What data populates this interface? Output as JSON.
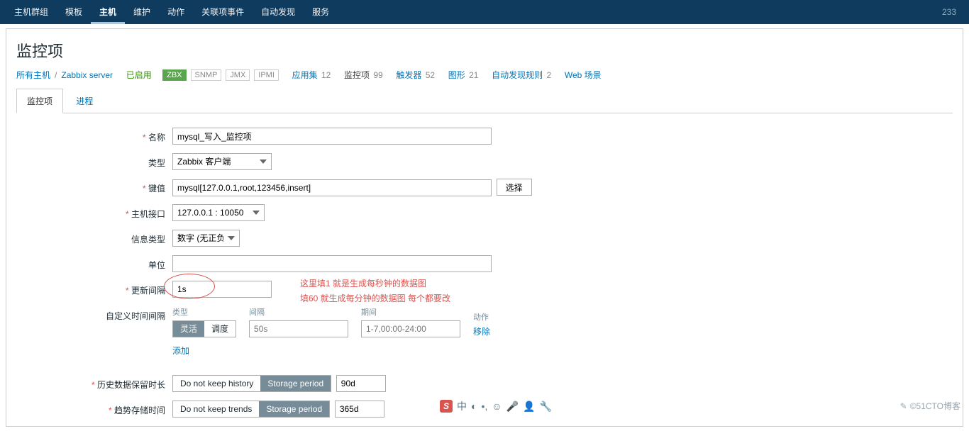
{
  "topnav": {
    "items": [
      "主机群组",
      "模板",
      "主机",
      "维护",
      "动作",
      "关联项事件",
      "自动发现",
      "服务"
    ],
    "active_index": 2,
    "right_count": "233"
  },
  "page_title": "监控项",
  "breadcrumb": {
    "all_hosts": "所有主机",
    "host": "Zabbix server",
    "enabled": "已启用",
    "tags": {
      "zbx": "ZBX",
      "snmp": "SNMP",
      "jmx": "JMX",
      "ipmi": "IPMI"
    },
    "metrics": [
      {
        "label": "应用集",
        "count": "12"
      },
      {
        "label": "监控项",
        "count": "99",
        "current": true
      },
      {
        "label": "触发器",
        "count": "52"
      },
      {
        "label": "图形",
        "count": "21"
      },
      {
        "label": "自动发现规则",
        "count": "2"
      },
      {
        "label": "Web 场景",
        "count": ""
      }
    ]
  },
  "tabs": {
    "item": "监控项",
    "proc": "进程"
  },
  "form": {
    "name_label": "名称",
    "name_value": "mysql_写入_监控项",
    "type_label": "类型",
    "type_value": "Zabbix 客户端",
    "key_label": "键值",
    "key_value": "mysql[127.0.0.1,root,123456,insert]",
    "key_select": "选择",
    "iface_label": "主机接口",
    "iface_value": "127.0.0.1 : 10050",
    "info_label": "信息类型",
    "info_value": "数字 (无正负)",
    "unit_label": "单位",
    "unit_value": "",
    "interval_label": "更新间隔",
    "interval_value": "1s",
    "custom_label": "自定义时间间隔",
    "col_type": "类型",
    "col_int": "间隔",
    "col_period": "期间",
    "col_action": "动作",
    "seg_flex": "灵活",
    "seg_sched": "调度",
    "int_ph": "50s",
    "period_ph": "1-7,00:00-24:00",
    "remove": "移除",
    "add": "添加",
    "hist_label": "历史数据保留时长",
    "hist_a": "Do not keep history",
    "hist_b": "Storage period",
    "hist_val": "90d",
    "trend_label": "趋势存储时间",
    "trend_a": "Do not keep trends",
    "trend_b": "Storage period",
    "trend_val": "365d"
  },
  "annotation": {
    "line1": "这里填1 就是生成每秒钟的数据图",
    "line2": "填60 就生成每分钟的数据图 每个都要改"
  },
  "watermark": "©51CTO博客"
}
